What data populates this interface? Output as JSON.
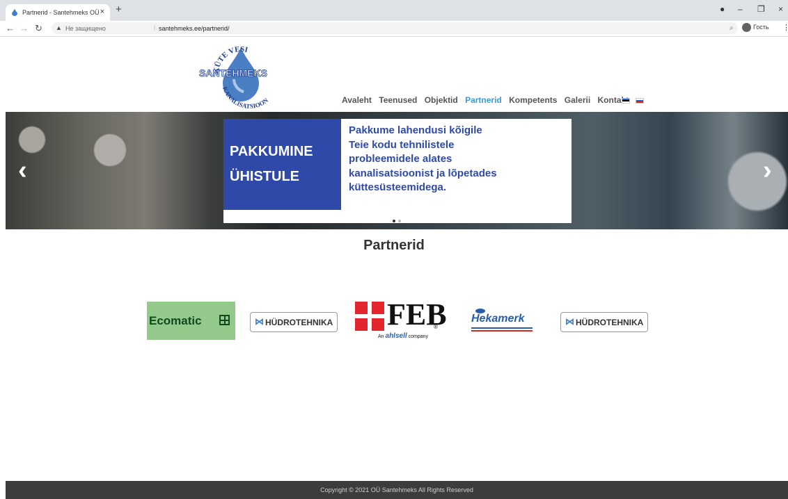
{
  "browser": {
    "tab_title": "Partnerid - Santehmeks OÜ",
    "tab_close": "×",
    "new_tab": "+",
    "not_secure": "Не защищено",
    "url": "santehmeks.ee/partnerid/",
    "profile_label": "Гость",
    "window_controls": {
      "minimize": "–",
      "restore": "❐",
      "close": "×"
    },
    "icons": [
      "back-icon",
      "forward-icon",
      "reload-icon",
      "warning-icon",
      "zoom-icon",
      "profile-icon",
      "menu-icon"
    ]
  },
  "logo": {
    "top_text": "KÜTE VESI",
    "name": "SANTEHMEKS",
    "bottom_text": "KANALISATSIOON"
  },
  "nav": {
    "items": [
      {
        "label": "Avaleht",
        "active": false
      },
      {
        "label": "Teenused",
        "active": false
      },
      {
        "label": "Objektid",
        "active": false
      },
      {
        "label": "Partnerid",
        "active": true
      },
      {
        "label": "Kompetents",
        "active": false
      },
      {
        "label": "Galerii",
        "active": false
      },
      {
        "label": "Kontakt",
        "active": false
      }
    ],
    "languages": [
      "Eesti",
      "Русский"
    ],
    "active_color": "#3a9ad9"
  },
  "slider": {
    "left_arrow": "‹",
    "right_arrow": "›",
    "slide": {
      "headline_line1": "PAKKUMINE",
      "headline_line2": "ÜHISTULE",
      "text_lines": [
        "Pakkume lahendusi kõigile",
        "Teie kodu tehnilistele",
        "probleemidele alates",
        "kanalisatsioonist ja lõpetades",
        "küttesüsteemidega."
      ]
    },
    "dot_count": 2,
    "active_dot": 0,
    "brand_color": "#2e49a8"
  },
  "content": {
    "heading": "Partnerid",
    "partners": [
      {
        "name": "Ecomatic"
      },
      {
        "name": "HÜDROTEHNIKA",
        "mark": "⋈"
      },
      {
        "name": "FEB",
        "registered": "®",
        "sub_prefix": "An",
        "sub_brand": "ahlsell",
        "sub_suffix": "company"
      },
      {
        "name": "Hekamerk"
      },
      {
        "name": "HÜDROTEHNIKA",
        "mark": "⋈"
      }
    ]
  },
  "footer": {
    "copyright": "Copyright © 2021 OÜ Santehmeks All Rights Reserved"
  }
}
